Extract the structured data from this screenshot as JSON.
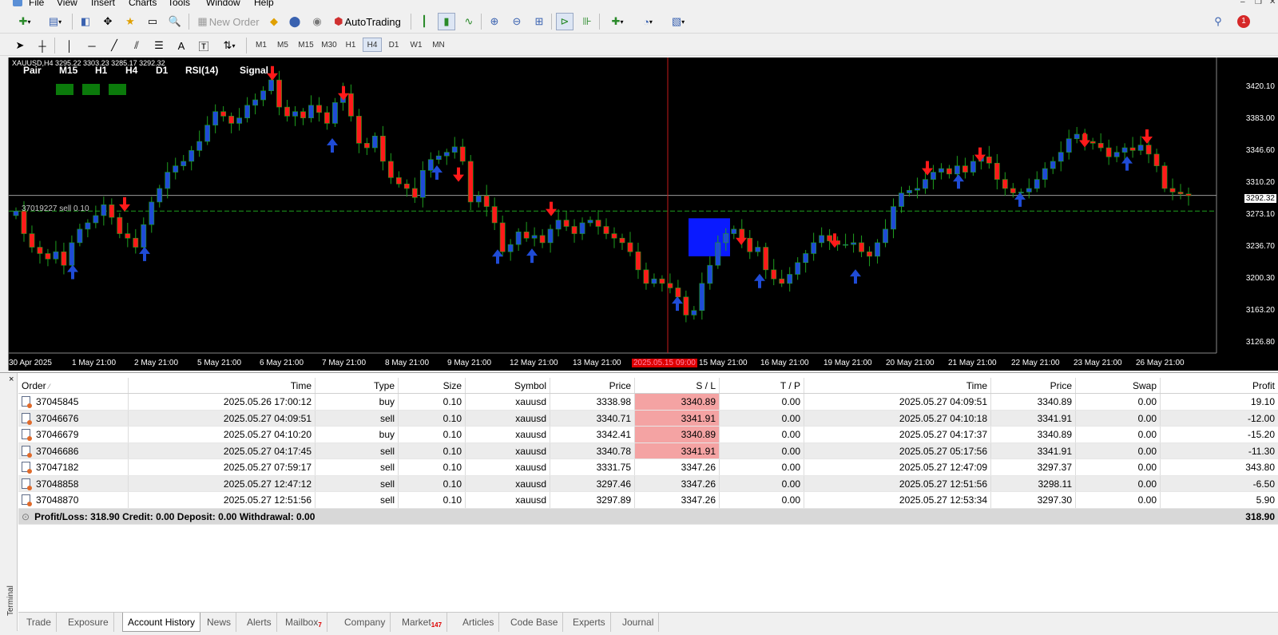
{
  "menu": [
    "File",
    "View",
    "Insert",
    "Charts",
    "Tools",
    "Window",
    "Help"
  ],
  "toolbar": {
    "new_order": "New Order",
    "autotrading": "AutoTrading",
    "timeframes": [
      "M1",
      "M5",
      "M15",
      "M30",
      "H1",
      "H4",
      "D1",
      "W1",
      "MN"
    ],
    "active_timeframe": "H4",
    "drawing_text": "A"
  },
  "chart": {
    "header": "XAUUSD,H4  3295.22 3303.23 3285.17 3292.32",
    "indicator_labels": [
      "Pair",
      "M15",
      "H1",
      "H4",
      "D1",
      "RSI(14)",
      "Signal"
    ],
    "order_line_label": "37019227 sell 0.10",
    "current_price": "3292.32",
    "price_axis": [
      "3420.10",
      "3383.00",
      "3346.60",
      "3310.20",
      "3273.10",
      "3236.70",
      "3200.30",
      "3163.20",
      "3126.80"
    ],
    "time_axis": [
      "30 Apr 2025",
      "1 May 21:00",
      "2 May 21:00",
      "5 May 21:00",
      "6 May 21:00",
      "7 May 21:00",
      "8 May 21:00",
      "9 May 21:00",
      "12 May 21:00",
      "13 May 21:00",
      "2025.05.15 09:00",
      "15 May 21:00",
      "16 May 21:00",
      "19 May 21:00",
      "20 May 21:00",
      "21 May 21:00",
      "22 May 21:00",
      "23 May 21:00",
      "26 May 21:00"
    ],
    "colors": {
      "bull": "#1f4bd6",
      "bear": "#ff1a1a",
      "signal_down": "#ff1a1a",
      "signal_up": "#1f4bd6",
      "indicator_box": "#0b7a0b"
    }
  },
  "history": {
    "columns": [
      "Order",
      "Time",
      "Type",
      "Size",
      "Symbol",
      "Price",
      "S / L",
      "T / P",
      "Time",
      "Price",
      "Swap",
      "Profit"
    ],
    "rows": [
      {
        "order": "37045845",
        "time": "2025.05.26 17:00:12",
        "type": "buy",
        "size": "0.10",
        "symbol": "xauusd",
        "price": "3338.98",
        "sl": "3340.89",
        "tp": "0.00",
        "close_time": "2025.05.27 04:09:51",
        "close_price": "3340.89",
        "swap": "0.00",
        "profit": "19.10",
        "sl_hl": true
      },
      {
        "order": "37046676",
        "time": "2025.05.27 04:09:51",
        "type": "sell",
        "size": "0.10",
        "symbol": "xauusd",
        "price": "3340.71",
        "sl": "3341.91",
        "tp": "0.00",
        "close_time": "2025.05.27 04:10:18",
        "close_price": "3341.91",
        "swap": "0.00",
        "profit": "-12.00",
        "sl_hl": true
      },
      {
        "order": "37046679",
        "time": "2025.05.27 04:10:20",
        "type": "buy",
        "size": "0.10",
        "symbol": "xauusd",
        "price": "3342.41",
        "sl": "3340.89",
        "tp": "0.00",
        "close_time": "2025.05.27 04:17:37",
        "close_price": "3340.89",
        "swap": "0.00",
        "profit": "-15.20",
        "sl_hl": true
      },
      {
        "order": "37046686",
        "time": "2025.05.27 04:17:45",
        "type": "sell",
        "size": "0.10",
        "symbol": "xauusd",
        "price": "3340.78",
        "sl": "3341.91",
        "tp": "0.00",
        "close_time": "2025.05.27 05:17:56",
        "close_price": "3341.91",
        "swap": "0.00",
        "profit": "-11.30",
        "sl_hl": true
      },
      {
        "order": "37047182",
        "time": "2025.05.27 07:59:17",
        "type": "sell",
        "size": "0.10",
        "symbol": "xauusd",
        "price": "3331.75",
        "sl": "3347.26",
        "tp": "0.00",
        "close_time": "2025.05.27 12:47:09",
        "close_price": "3297.37",
        "swap": "0.00",
        "profit": "343.80",
        "sl_hl": false
      },
      {
        "order": "37048858",
        "time": "2025.05.27 12:47:12",
        "type": "sell",
        "size": "0.10",
        "symbol": "xauusd",
        "price": "3297.46",
        "sl": "3347.26",
        "tp": "0.00",
        "close_time": "2025.05.27 12:51:56",
        "close_price": "3298.11",
        "swap": "0.00",
        "profit": "-6.50",
        "sl_hl": false
      },
      {
        "order": "37048870",
        "time": "2025.05.27 12:51:56",
        "type": "sell",
        "size": "0.10",
        "symbol": "xauusd",
        "price": "3297.89",
        "sl": "3347.26",
        "tp": "0.00",
        "close_time": "2025.05.27 12:53:34",
        "close_price": "3297.30",
        "swap": "0.00",
        "profit": "5.90",
        "sl_hl": false
      }
    ],
    "summary": "Profit/Loss: 318.90  Credit: 0.00  Deposit: 0.00  Withdrawal: 0.00",
    "summary_total": "318.90"
  },
  "tabs": [
    {
      "label": "Trade"
    },
    {
      "label": "Exposure"
    },
    {
      "label": "Account History",
      "active": true
    },
    {
      "label": "News"
    },
    {
      "label": "Alerts"
    },
    {
      "label": "Mailbox",
      "badge": "7"
    },
    {
      "label": "Company"
    },
    {
      "label": "Market",
      "badge": "147"
    },
    {
      "label": "Articles"
    },
    {
      "label": "Code Base"
    },
    {
      "label": "Experts"
    },
    {
      "label": "Journal"
    }
  ],
  "terminal_label": "Terminal"
}
